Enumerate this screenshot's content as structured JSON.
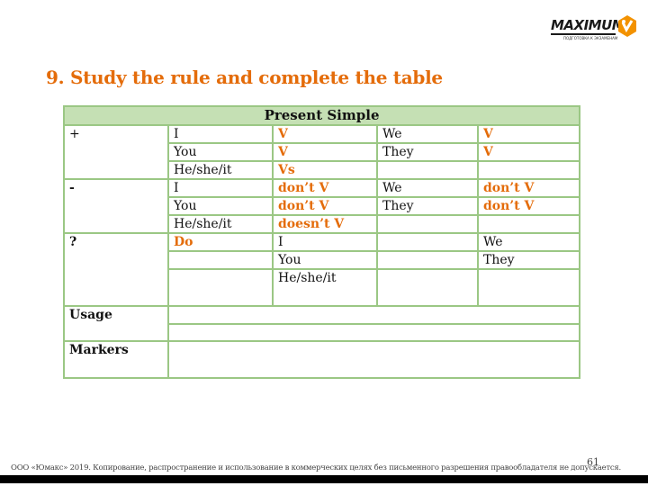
{
  "logo": {
    "name": "MAXIMUM",
    "tagline": "ПОДГОТОВКА К ЭКЗАМЕНАМ",
    "accent_color": "#f39200"
  },
  "title": "9. Study the rule and complete the table",
  "colors": {
    "title": "#e46c0a",
    "table_border": "#9bc784",
    "table_header_bg": "#c5e0b4",
    "answer_text": "#e46c0a"
  },
  "table": {
    "header": "Present Simple",
    "affirmative": {
      "label": "+",
      "rows": [
        {
          "pronoun": "I",
          "form": "V",
          "pronoun2": "We",
          "form2": "V"
        },
        {
          "pronoun": "You",
          "form": "V",
          "pronoun2": "They",
          "form2": "V"
        },
        {
          "pronoun": "He/she/it",
          "form": "Vs",
          "pronoun2": "",
          "form2": ""
        }
      ]
    },
    "negative": {
      "label": "-",
      "rows": [
        {
          "pronoun": "I",
          "form": "don’t V",
          "pronoun2": "We",
          "form2": "don’t V"
        },
        {
          "pronoun": "You",
          "form": "don’t V",
          "pronoun2": "They",
          "form2": "don’t V"
        },
        {
          "pronoun": "He/she/it",
          "form": "doesn’t V",
          "pronoun2": "",
          "form2": ""
        }
      ]
    },
    "question": {
      "label": "?",
      "rows": [
        {
          "aux": "Do",
          "pronoun": "I",
          "blank": "",
          "pronoun2": "We"
        },
        {
          "aux": "",
          "pronoun": "You",
          "blank": "",
          "pronoun2": "They"
        },
        {
          "aux": "",
          "pronoun": "He/she/it",
          "blank": "",
          "pronoun2": ""
        }
      ]
    },
    "usage_label": "Usage",
    "markers_label": "Markers"
  },
  "footer": {
    "copyright": "ООО «Юмакс» 2019. Копирование, распространение и использование в коммерческих целях без письменного разрешения правообладателя не допускается.",
    "page_number": "61"
  }
}
